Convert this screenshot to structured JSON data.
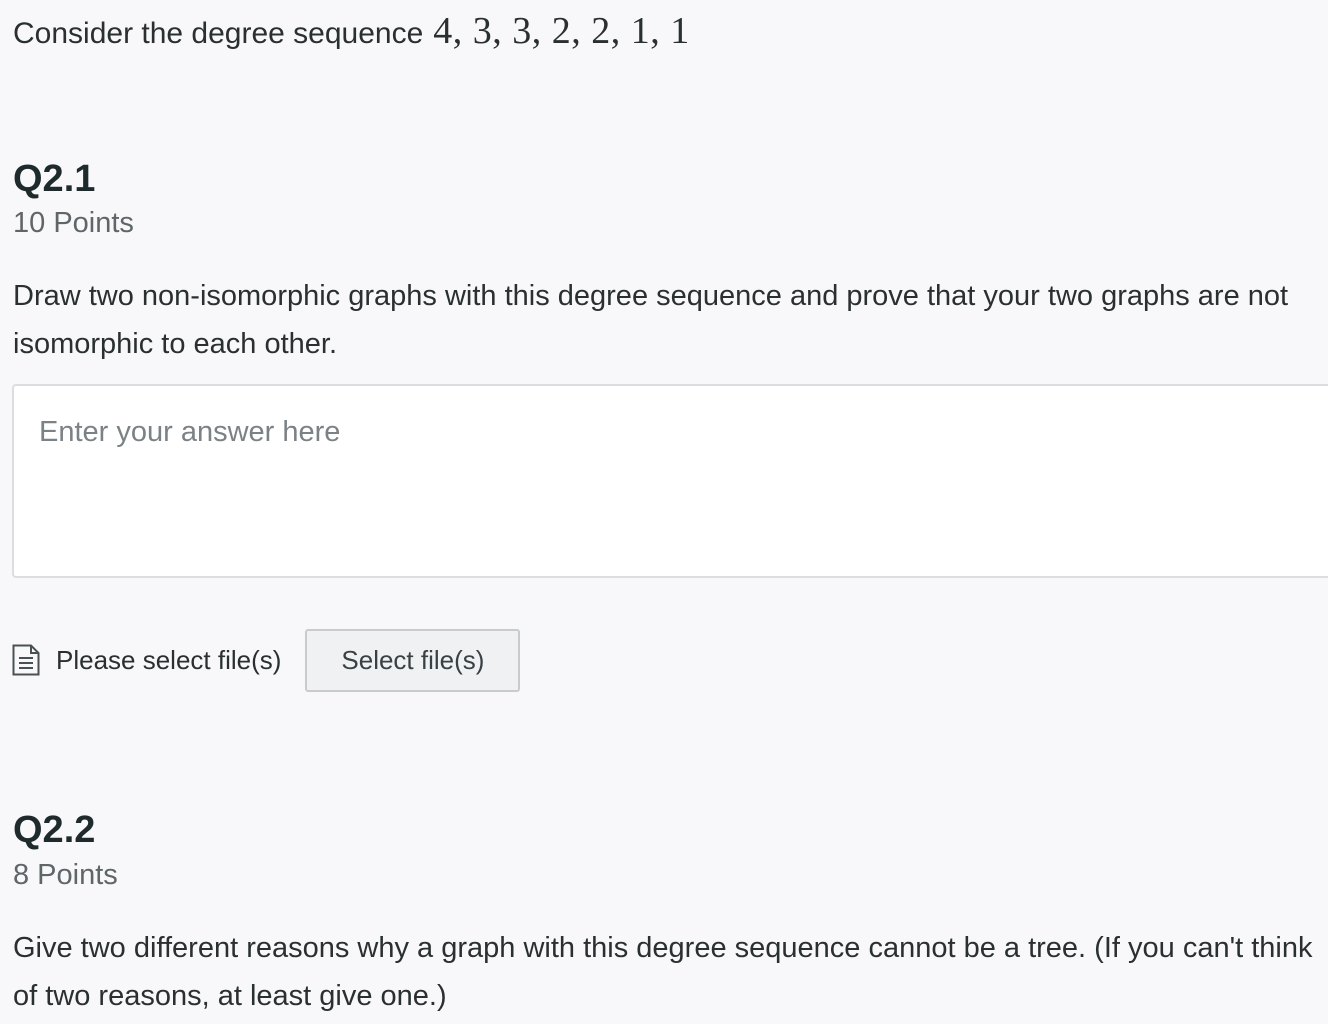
{
  "intro": {
    "text": "Consider the degree sequence",
    "sequence": "4, 3, 3, 2, 2, 1, 1"
  },
  "questions": [
    {
      "title": "Q2.1",
      "points": "10 Points",
      "prompt": "Draw two non-isomorphic graphs with this degree sequence and prove that your two graphs are not isomorphic to each other.",
      "answer": {
        "placeholder": "Enter your answer here",
        "value": ""
      },
      "file_upload": {
        "icon": "document-icon",
        "status_label": "Please select file(s)",
        "button_label": "Select file(s)"
      }
    },
    {
      "title": "Q2.2",
      "points": "8 Points",
      "prompt": "Give two different reasons why a graph with this degree sequence cannot be a tree. (If you can't think of two reasons, at least give one.)"
    }
  ]
}
